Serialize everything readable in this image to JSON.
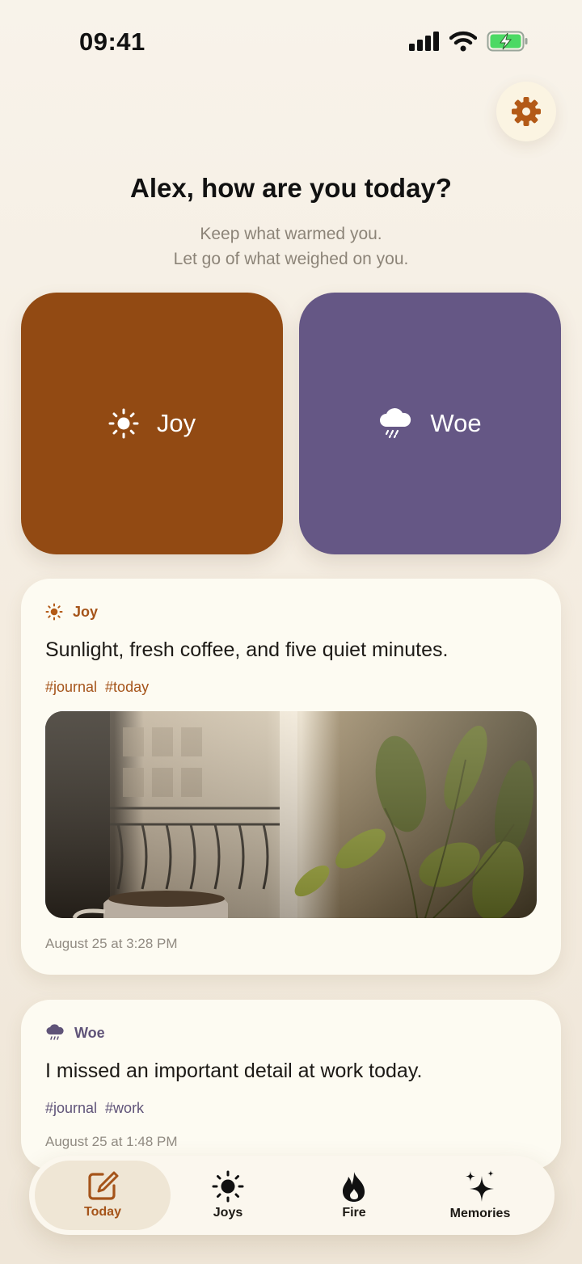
{
  "status": {
    "time": "09:41"
  },
  "header": {
    "greeting": "Alex, how are you today?",
    "subtitle_line1": "Keep what warmed you.",
    "subtitle_line2": "Let go of what weighed on you."
  },
  "mood_buttons": {
    "joy": {
      "label": "Joy",
      "icon": "sun-icon",
      "color": "#924a13"
    },
    "woe": {
      "label": "Woe",
      "icon": "rain-cloud-icon",
      "color": "#655785"
    }
  },
  "entries": [
    {
      "type": "Joy",
      "text": "Sunlight, fresh coffee, and five quiet minutes.",
      "tags": [
        "#journal",
        "#today"
      ],
      "timestamp": "August 25 at 3:28 PM",
      "accent": "#a5541a"
    },
    {
      "type": "Woe",
      "text": "I missed an important detail at work today.",
      "tags": [
        "#journal",
        "#work"
      ],
      "timestamp": "August 25 at 1:48 PM",
      "accent": "#5f5378"
    }
  ],
  "tabs": [
    {
      "label": "Today",
      "icon": "edit-icon",
      "active": true
    },
    {
      "label": "Joys",
      "icon": "sun-icon",
      "active": false
    },
    {
      "label": "Fire",
      "icon": "flame-icon",
      "active": false
    },
    {
      "label": "Memories",
      "icon": "sparkles-icon",
      "active": false
    }
  ]
}
